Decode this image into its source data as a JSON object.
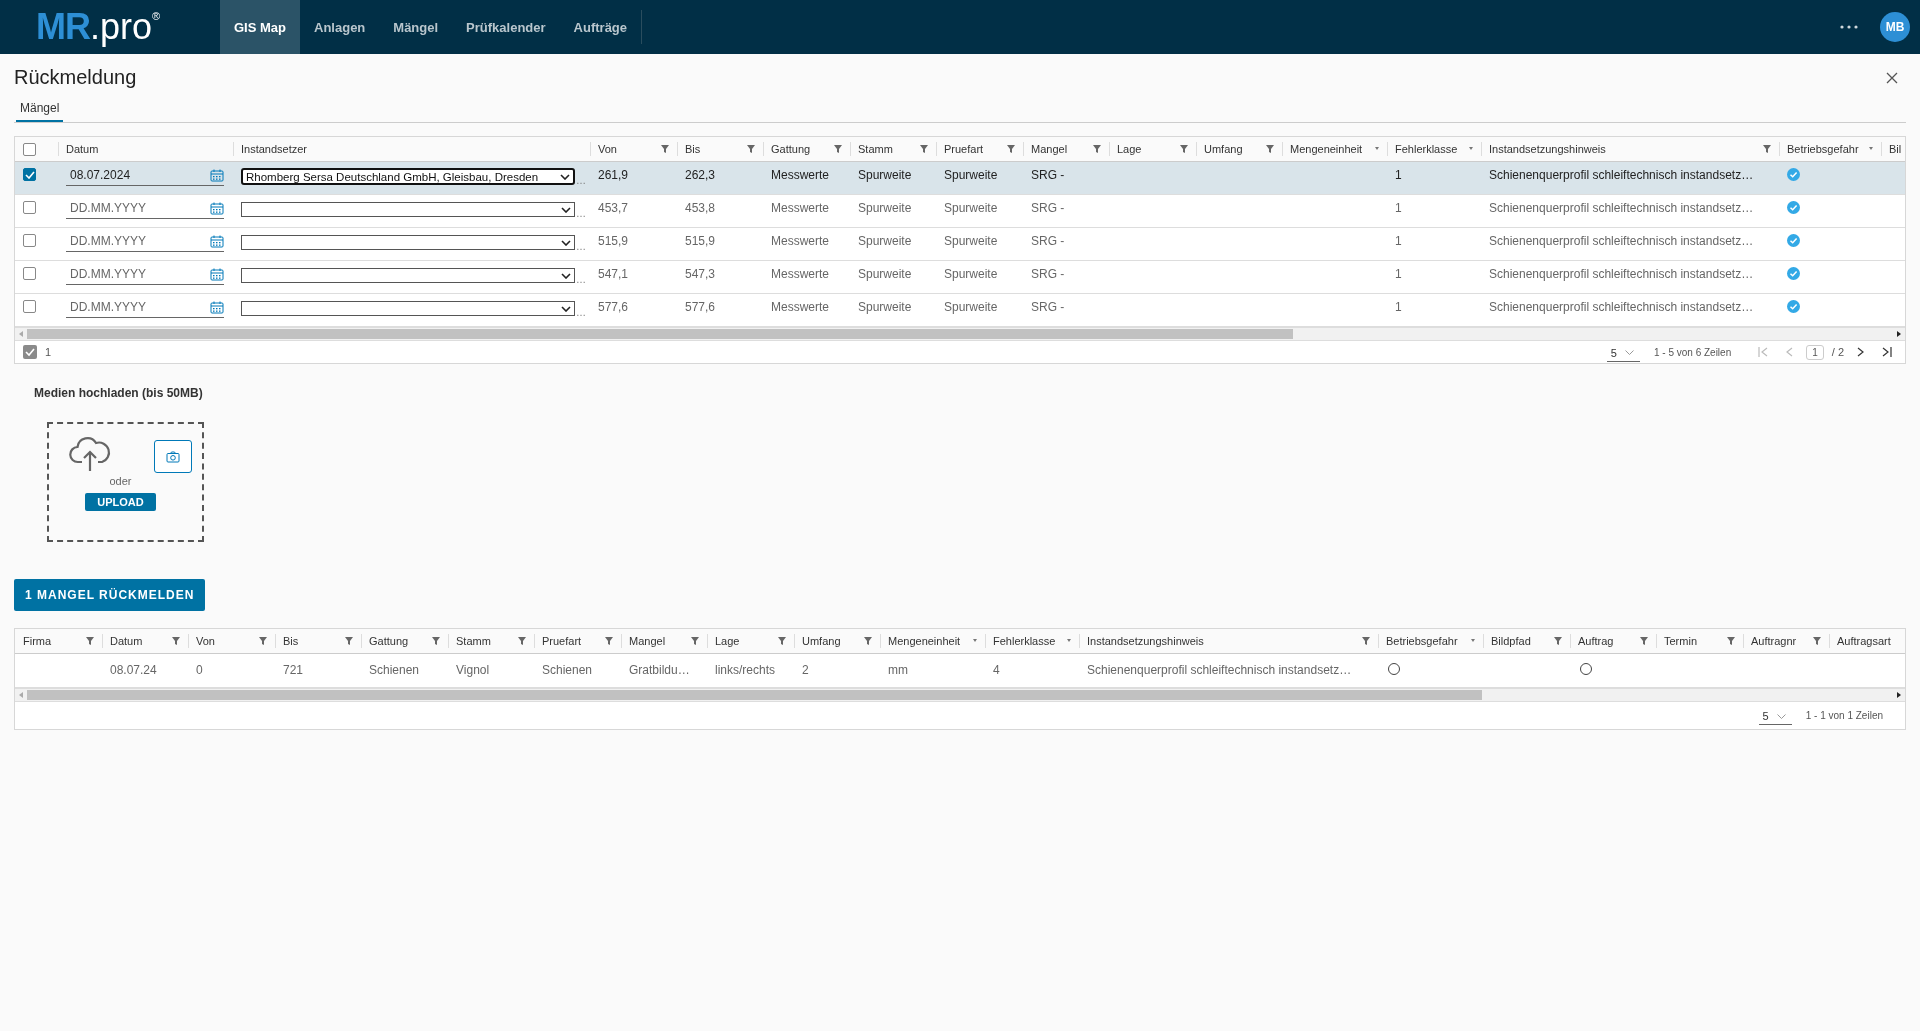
{
  "nav": {
    "logo_main": "MR",
    "logo_sub": ".pro",
    "logo_mark": "®",
    "items": [
      {
        "label": "GIS Map",
        "selected": true
      },
      {
        "label": "Anlagen",
        "selected": false
      },
      {
        "label": "Mängel",
        "selected": false
      },
      {
        "label": "Prüfkalender",
        "selected": false
      },
      {
        "label": "Aufträge",
        "selected": false
      }
    ],
    "avatar": "MB"
  },
  "dialog": {
    "title": "Rückmeldung",
    "tabs": [
      {
        "label": "Mängel",
        "selected": true
      }
    ]
  },
  "top_table": {
    "header_checked": false,
    "columns": [
      {
        "label": "Datum",
        "kind": "none"
      },
      {
        "label": "Instandsetzer",
        "kind": "none"
      },
      {
        "label": "Von",
        "kind": "filter"
      },
      {
        "label": "Bis",
        "kind": "filter"
      },
      {
        "label": "Gattung",
        "kind": "filter"
      },
      {
        "label": "Stamm",
        "kind": "filter"
      },
      {
        "label": "Pruefart",
        "kind": "filter"
      },
      {
        "label": "Mangel",
        "kind": "filter"
      },
      {
        "label": "Lage",
        "kind": "filter"
      },
      {
        "label": "Umfang",
        "kind": "filter"
      },
      {
        "label": "Mengeneinheit",
        "kind": "sort"
      },
      {
        "label": "Fehlerklasse",
        "kind": "sort"
      },
      {
        "label": "Instandsetzungshinweis",
        "kind": "filter"
      },
      {
        "label": "Betriebsgefahr",
        "kind": "sort"
      },
      {
        "label": "Bil",
        "kind": "none"
      }
    ],
    "rows": [
      {
        "checked": true,
        "selected": true,
        "date": "08.07.2024",
        "instandsetzer": "Rhomberg Sersa Deutschland GmbH, Gleisbau, Dresden",
        "more": "…",
        "von": "261,9",
        "bis": "262,3",
        "gattung": "Messwerte",
        "stamm": "Spurweite",
        "pruefart": "Spurweite",
        "mangel": "SRG -",
        "fehlerklasse": "1",
        "hinweis": "Schienenquerprofil schleiftechnisch instandsetz…",
        "betriebsgefahr": true
      },
      {
        "checked": false,
        "selected": false,
        "date_placeholder": "DD.MM.YYYY",
        "more": "…",
        "von": "453,7",
        "bis": "453,8",
        "gattung": "Messwerte",
        "stamm": "Spurweite",
        "pruefart": "Spurweite",
        "mangel": "SRG -",
        "fehlerklasse": "1",
        "hinweis": "Schienenquerprofil schleiftechnisch instandsetz…",
        "betriebsgefahr": true
      },
      {
        "checked": false,
        "selected": false,
        "date_placeholder": "DD.MM.YYYY",
        "more": "…",
        "von": "515,9",
        "bis": "515,9",
        "gattung": "Messwerte",
        "stamm": "Spurweite",
        "pruefart": "Spurweite",
        "mangel": "SRG -",
        "fehlerklasse": "1",
        "hinweis": "Schienenquerprofil schleiftechnisch instandsetz…",
        "betriebsgefahr": true
      },
      {
        "checked": false,
        "selected": false,
        "date_placeholder": "DD.MM.YYYY",
        "more": "…",
        "von": "547,1",
        "bis": "547,3",
        "gattung": "Messwerte",
        "stamm": "Spurweite",
        "pruefart": "Spurweite",
        "mangel": "SRG -",
        "fehlerklasse": "1",
        "hinweis": "Schienenquerprofil schleiftechnisch instandsetz…",
        "betriebsgefahr": true
      },
      {
        "checked": false,
        "selected": false,
        "date_placeholder": "DD.MM.YYYY",
        "more": "…",
        "von": "577,6",
        "bis": "577,6",
        "gattung": "Messwerte",
        "stamm": "Spurweite",
        "pruefart": "Spurweite",
        "mangel": "SRG -",
        "fehlerklasse": "1",
        "hinweis": "Schienenquerprofil schleiftechnisch instandsetz…",
        "betriebsgefahr": true
      }
    ],
    "selected_count": "1",
    "page_size": "5",
    "range": "1 - 5 von 6 Zeilen",
    "page": "1",
    "pages": "/ 2"
  },
  "upload": {
    "label": "Medien hochladen (bis 50MB)",
    "or": "oder",
    "button": "UPLOAD"
  },
  "submit_button": "1 MANGEL RÜCKMELDEN",
  "bottom_table": {
    "columns": [
      {
        "label": "Firma",
        "kind": "filter"
      },
      {
        "label": "Datum",
        "kind": "filter"
      },
      {
        "label": "Von",
        "kind": "filter"
      },
      {
        "label": "Bis",
        "kind": "filter"
      },
      {
        "label": "Gattung",
        "kind": "filter"
      },
      {
        "label": "Stamm",
        "kind": "filter"
      },
      {
        "label": "Pruefart",
        "kind": "filter"
      },
      {
        "label": "Mangel",
        "kind": "filter"
      },
      {
        "label": "Lage",
        "kind": "filter"
      },
      {
        "label": "Umfang",
        "kind": "filter"
      },
      {
        "label": "Mengeneinheit",
        "kind": "sort"
      },
      {
        "label": "Fehlerklasse",
        "kind": "sort"
      },
      {
        "label": "Instandsetzungshinweis",
        "kind": "filter"
      },
      {
        "label": "Betriebsgefahr",
        "kind": "sort"
      },
      {
        "label": "Bildpfad",
        "kind": "filter"
      },
      {
        "label": "Auftrag",
        "kind": "filter"
      },
      {
        "label": "Termin",
        "kind": "filter"
      },
      {
        "label": "Auftragnr",
        "kind": "filter"
      },
      {
        "label": "Auftragsart",
        "kind": "none"
      }
    ],
    "rows": [
      {
        "cells": [
          {
            "kind": "text"
          },
          {
            "kind": "text",
            "text": "08.07.24"
          },
          {
            "kind": "text",
            "text": "0"
          },
          {
            "kind": "text",
            "text": "721"
          },
          {
            "kind": "text",
            "text": "Schienen"
          },
          {
            "kind": "text",
            "text": "Vignol"
          },
          {
            "kind": "text",
            "text": "Schienen"
          },
          {
            "kind": "text",
            "text": "Gratbildu…"
          },
          {
            "kind": "text",
            "text": "links/rechts"
          },
          {
            "kind": "text",
            "text": "2"
          },
          {
            "kind": "text",
            "text": "mm"
          },
          {
            "kind": "text",
            "text": "4"
          },
          {
            "kind": "text",
            "text": "Schienenquerprofil schleiftechnisch instandsetz…"
          },
          {
            "kind": "radio",
            "checked": false
          },
          {
            "kind": "text"
          },
          {
            "kind": "radio",
            "checked": false
          },
          {
            "kind": "text"
          },
          {
            "kind": "text"
          },
          {
            "kind": "text"
          }
        ]
      }
    ],
    "page_size": "5",
    "range": "1 - 1 von 1 Zeilen"
  }
}
